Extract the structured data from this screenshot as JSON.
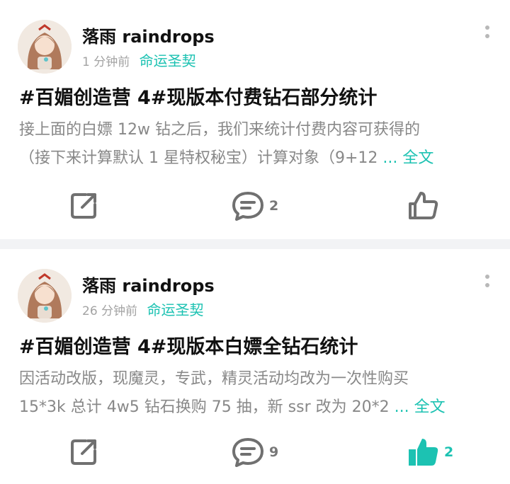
{
  "posts": [
    {
      "author": "落雨 raindrops",
      "time": "1 分钟前",
      "tag": "命运圣契",
      "title": "#百媚创造营 4#现版本付费钻石部分统计",
      "excerpt_line1": "接上面的白嫖 12w 钻之后，我们来统计付费内容可获得的",
      "excerpt_line2": "（接下来计算默认 1 星特权秘宝）计算对象（9+12",
      "ellipsis": " ...",
      "full_text_link": " 全文",
      "comment_count": "2",
      "like_count": "",
      "liked": false
    },
    {
      "author": "落雨 raindrops",
      "time": "26 分钟前",
      "tag": "命运圣契",
      "title": "#百媚创造营 4#现版本白嫖全钻石统计",
      "excerpt_line1": "因活动改版，现魔灵，专武，精灵活动均改为一次性购买",
      "excerpt_line2": "15*3k 总计 4w5 钻石换购 75 抽，新 ssr 改为 20*2",
      "ellipsis": " ...",
      "full_text_link": " 全文",
      "comment_count": "9",
      "like_count": "2",
      "liked": true
    }
  ],
  "icons": {
    "share": "share-icon",
    "comment": "comment-icon",
    "like": "thumbs-up-icon",
    "more": "more-vertical-icon"
  },
  "colors": {
    "accent": "#1cc2b2",
    "muted": "#888888",
    "icon": "#707070"
  }
}
